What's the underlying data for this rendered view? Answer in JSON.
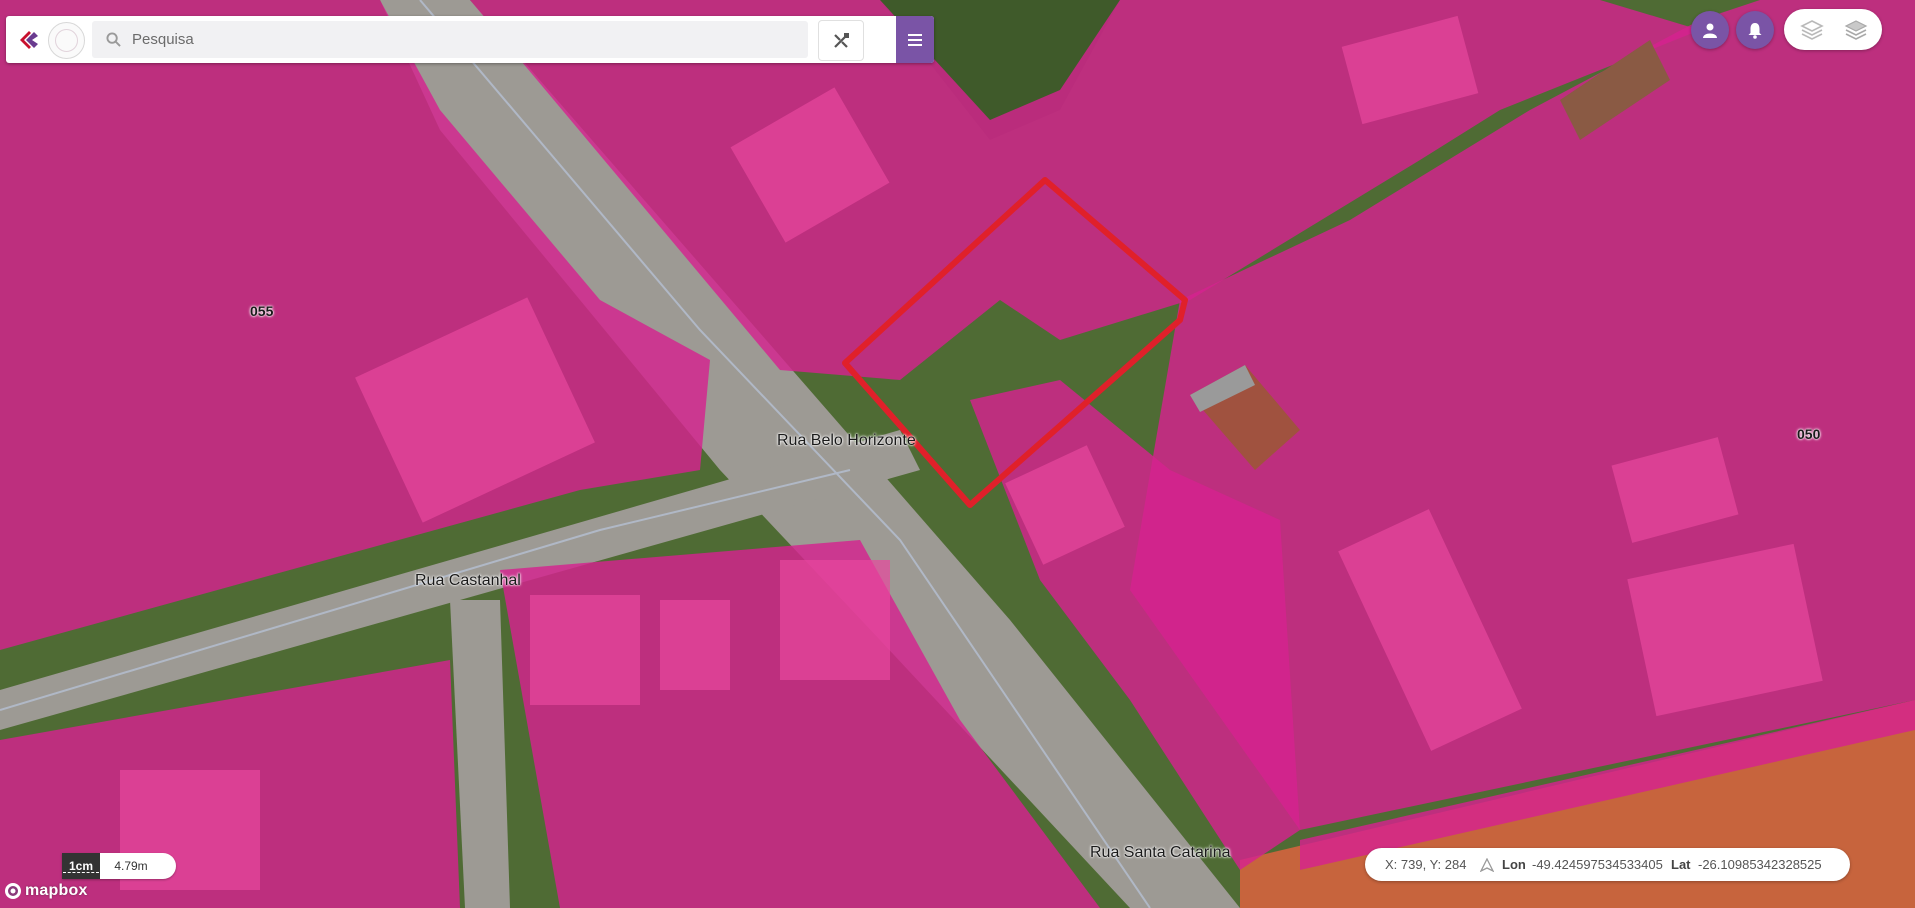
{
  "search": {
    "placeholder": "Pesquisa"
  },
  "icons": {
    "logo": "logo-icon",
    "seal": "seal-icon",
    "search": "search-icon",
    "tool": "measure-tool-icon",
    "menu": "hamburger-menu-icon",
    "user": "user-icon",
    "notifications": "bell-icon",
    "layers_outline": "layers-icon",
    "layers_filled": "layers-icon",
    "north": "north-arrow-icon",
    "mapbox": "mapbox-logo-icon"
  },
  "colors": {
    "accent": "#7a54a6",
    "overlay": "#d6228f",
    "selection": "#e0202a"
  },
  "map": {
    "streets": [
      "Rua Belo Horizonte",
      "Rua Castanhal",
      "Rua Santa Catarina"
    ],
    "parcels": [
      "055",
      "050"
    ]
  },
  "scale": {
    "unit": "1cm",
    "value": "4.79m"
  },
  "coords": {
    "xy": "X: 739, Y: 284",
    "lon_label": "Lon",
    "lon_value": "-49.424597534533405",
    "lat_label": "Lat",
    "lat_value": "-26.10985342328525"
  },
  "attribution": "mapbox"
}
